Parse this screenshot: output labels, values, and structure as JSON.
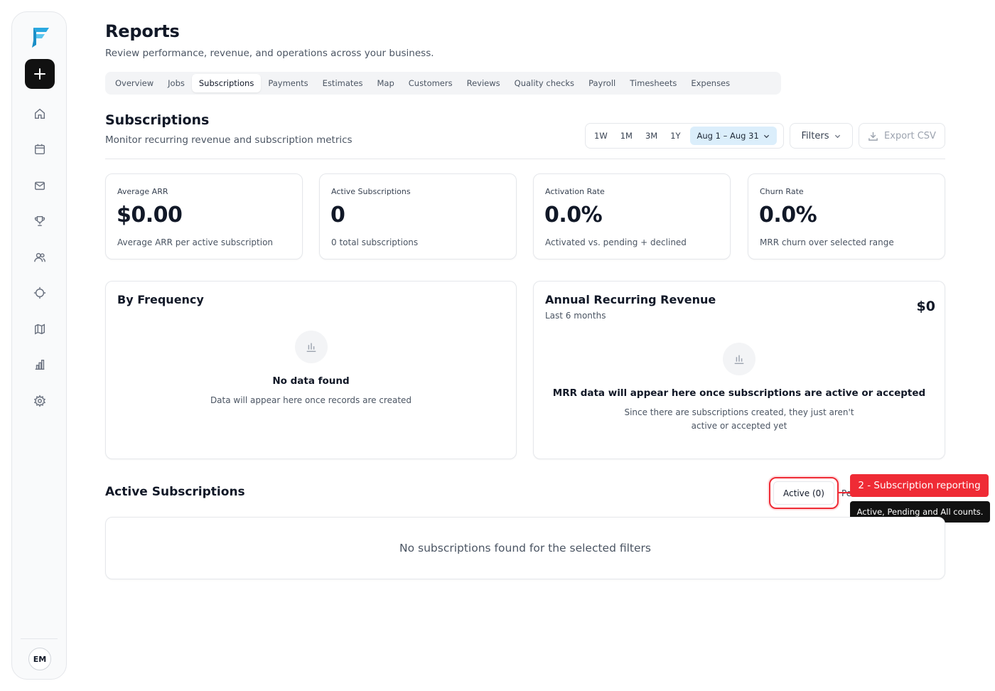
{
  "sidebar": {
    "avatar_initials": "EM",
    "icons": [
      "home-icon",
      "calendar-icon",
      "mail-icon",
      "trophy-icon",
      "users-icon",
      "target-icon",
      "map-icon",
      "bar-chart-icon",
      "gear-icon"
    ]
  },
  "header": {
    "title": "Reports",
    "subtitle": "Review performance, revenue, and operations across your business."
  },
  "tabs": [
    {
      "label": "Overview",
      "active": false
    },
    {
      "label": "Jobs",
      "active": false
    },
    {
      "label": "Subscriptions",
      "active": true
    },
    {
      "label": "Payments",
      "active": false
    },
    {
      "label": "Estimates",
      "active": false
    },
    {
      "label": "Map",
      "active": false
    },
    {
      "label": "Customers",
      "active": false
    },
    {
      "label": "Reviews",
      "active": false
    },
    {
      "label": "Quality checks",
      "active": false
    },
    {
      "label": "Payroll",
      "active": false
    },
    {
      "label": "Timesheets",
      "active": false
    },
    {
      "label": "Expenses",
      "active": false
    }
  ],
  "section": {
    "title": "Subscriptions",
    "subtitle": "Monitor recurring revenue and subscription metrics"
  },
  "toolbar": {
    "ranges": [
      "1W",
      "1M",
      "3M",
      "1Y"
    ],
    "date_range": "Aug 1 – Aug 31",
    "filters_label": "Filters",
    "export_label": "Export CSV"
  },
  "metrics": [
    {
      "label": "Average ARR",
      "value": "$0.00",
      "desc": "Average ARR per active subscription"
    },
    {
      "label": "Active Subscriptions",
      "value": "0",
      "desc": "0 total subscriptions"
    },
    {
      "label": "Activation Rate",
      "value": "0.0%",
      "desc": "Activated vs. pending + declined"
    },
    {
      "label": "Churn Rate",
      "value": "0.0%",
      "desc": "MRR churn over selected range"
    }
  ],
  "by_frequency": {
    "title": "By Frequency",
    "empty_title": "No data found",
    "empty_desc": "Data will appear here once records are created"
  },
  "arr_panel": {
    "title": "Annual Recurring Revenue",
    "subtitle": "Last 6 months",
    "amount": "$0",
    "empty_title": "MRR data will appear here once subscriptions are active or accepted",
    "empty_desc_line1": "Since there are subscriptions created, they just aren't",
    "empty_desc_line2": "active or accepted yet"
  },
  "active_subscriptions": {
    "title": "Active Subscriptions",
    "active_chip": "Active (0)",
    "hidden_chip": "Pe",
    "empty_text": "No subscriptions found for the selected filters"
  },
  "annotation": {
    "callout": "2 - Subscription reporting",
    "tooltip": "Active, Pending and All counts.",
    "accent_color": "#ef2b35"
  }
}
